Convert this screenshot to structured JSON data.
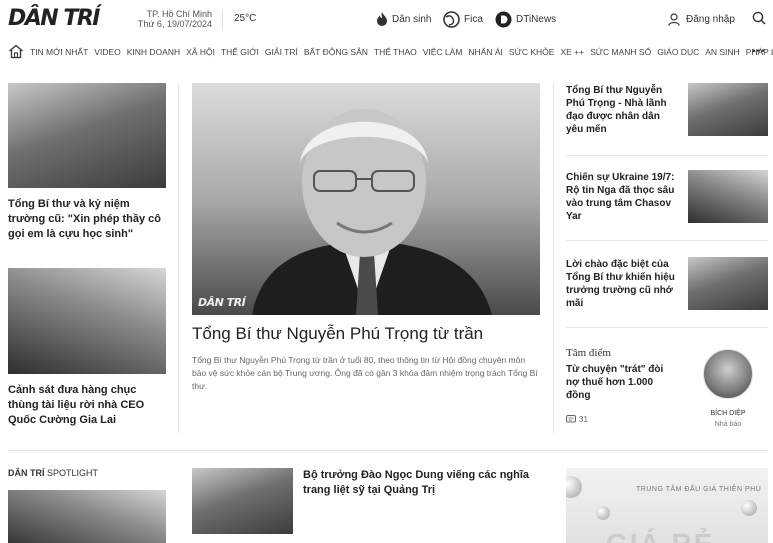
{
  "header": {
    "logo": "DÂN TRÍ",
    "location": "TP. Hồ Chí Minh",
    "date": "Thứ 6, 19/07/2024",
    "temperature": "25°C",
    "links": [
      {
        "label": "Dân sinh",
        "icon": "flame-icon"
      },
      {
        "label": "Fica",
        "icon": "globe-icon"
      },
      {
        "label": "DTiNews",
        "icon": "d-logo-icon"
      }
    ],
    "login": "Đăng nhập"
  },
  "nav": {
    "items": [
      "TIN MỚI NHẤT",
      "VIDEO",
      "KINH DOANH",
      "XÃ HỘI",
      "THẾ GIỚI",
      "GIẢI TRÍ",
      "BẤT ĐỘNG SẢN",
      "THỂ THAO",
      "VIỆC LÀM",
      "NHÂN ÁI",
      "SỨC KHỎE",
      "XE ++",
      "SỨC MẠNH SỐ",
      "GIÁO DỤC",
      "AN SINH",
      "PHÁP LUẬT"
    ],
    "more": "•••"
  },
  "left": [
    {
      "title": "Tổng Bí thư và kỷ niệm trường cũ: \"Xin phép thầy cô gọi em là cựu học sinh\""
    },
    {
      "title": "Cảnh sát đưa hàng chục thùng tài liệu rời nhà CEO Quốc Cường Gia Lai"
    }
  ],
  "hero": {
    "watermark": "DÂN TRÍ",
    "title": "Tổng Bí thư Nguyễn Phú Trọng từ trần",
    "sapo": "Tổng Bí thư Nguyễn Phú Trọng từ trần ở tuổi 80, theo thông tin từ Hội đồng chuyên môn bảo vệ sức khỏe cán bộ Trung ương. Ông đã có gần 3 khóa đảm nhiệm trọng trách Tổng Bí thư."
  },
  "right": [
    {
      "title": "Tổng Bí thư Nguyễn Phú Trọng - Nhà lãnh đạo được nhân dân yêu mến"
    },
    {
      "title": "Chiến sự Ukraine 19/7: Rộ tin Nga đã thọc sâu vào trung tâm Chasov Yar"
    },
    {
      "title": "Lời chào đặc biệt của Tổng Bí thư khiến hiệu trưởng trường cũ nhớ mãi"
    }
  ],
  "tamdiem": {
    "label": "Tâm điểm",
    "title": "Từ chuyện \"trát\" đòi nợ thuế hơn 1.000 đồng",
    "comments": "31",
    "author": "BÍCH DIỆP",
    "role": "Nhà báo"
  },
  "spotlight": {
    "brand": "DÂN TRÍ",
    "label": "SPOTLIGHT"
  },
  "bottom_story": {
    "title": "Bộ trưởng Đào Ngọc Dung viếng các nghĩa trang liệt sỹ tại Quảng Trị"
  },
  "ad": {
    "brand": "TRUNG TÂM ĐẤU GIÁ THIÊN PHÚ",
    "big": "GIÁ RẺ"
  }
}
